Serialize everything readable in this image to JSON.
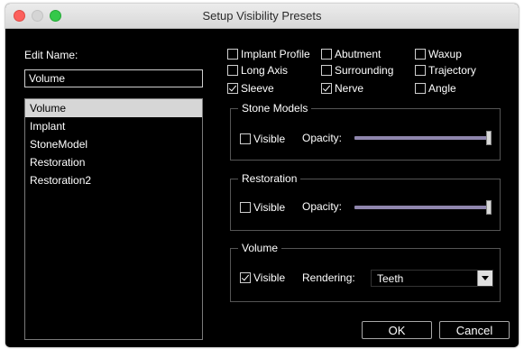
{
  "window": {
    "title": "Setup Visibility Presets"
  },
  "edit_name": {
    "label": "Edit Name:",
    "value": "Volume"
  },
  "presets": [
    {
      "label": "Volume",
      "selected": true
    },
    {
      "label": "Implant",
      "selected": false
    },
    {
      "label": "StoneModel",
      "selected": false
    },
    {
      "label": "Restoration",
      "selected": false
    },
    {
      "label": "Restoration2",
      "selected": false
    }
  ],
  "toggles": [
    {
      "label": "Implant Profile",
      "checked": false
    },
    {
      "label": "Abutment",
      "checked": false
    },
    {
      "label": "Waxup",
      "checked": false
    },
    {
      "label": "Long Axis",
      "checked": false
    },
    {
      "label": "Surrounding",
      "checked": false
    },
    {
      "label": "Trajectory",
      "checked": false
    },
    {
      "label": "Sleeve",
      "checked": true
    },
    {
      "label": "Nerve",
      "checked": true
    },
    {
      "label": "Angle",
      "checked": false
    }
  ],
  "stone_models": {
    "title": "Stone Models",
    "visible_label": "Visible",
    "visible": false,
    "opacity_label": "Opacity:",
    "opacity": 1.0
  },
  "restoration": {
    "title": "Restoration",
    "visible_label": "Visible",
    "visible": false,
    "opacity_label": "Opacity:",
    "opacity": 1.0
  },
  "volume": {
    "title": "Volume",
    "visible_label": "Visible",
    "visible": true,
    "rendering_label": "Rendering:",
    "rendering": "Teeth"
  },
  "buttons": {
    "ok": "OK",
    "cancel": "Cancel"
  },
  "colors": {
    "window_bg": "#000000",
    "slider_track": "#8f86ad",
    "selection": "#d6d6d6"
  }
}
